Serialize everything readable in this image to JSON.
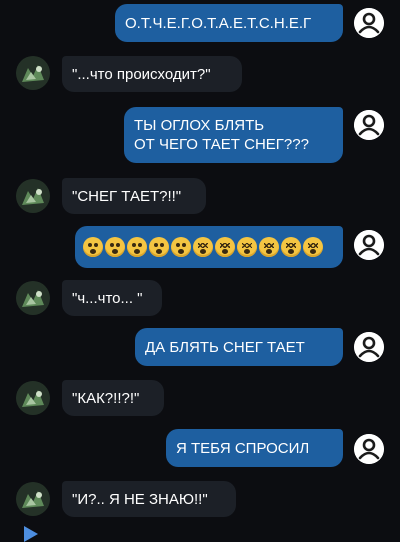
{
  "messages": [
    {
      "id": 1,
      "side": "out",
      "lines": [
        "О.Т.Ч.Е.Г.О.Т.А.Е.Т.С.Н.Е.Г"
      ]
    },
    {
      "id": 2,
      "side": "in",
      "lines": [
        "\"...что происходит?\""
      ]
    },
    {
      "id": 3,
      "side": "out",
      "lines": [
        "ТЫ ОГЛОХ БЛЯТЬ",
        "ОТ ЧЕГО ТАЕТ СНЕГ???"
      ]
    },
    {
      "id": 4,
      "side": "in",
      "lines": [
        "\"СНЕГ ТАЕТ?!!\""
      ]
    },
    {
      "id": 5,
      "side": "out",
      "emoji": [
        "😨",
        "😨",
        "😨",
        "😨",
        "😨",
        "😵",
        "😵",
        "😵",
        "😵",
        "😵",
        "😵"
      ]
    },
    {
      "id": 6,
      "side": "in",
      "lines": [
        "\"ч...что... \""
      ]
    },
    {
      "id": 7,
      "side": "out",
      "lines": [
        "ДА БЛЯТЬ СНЕГ ТАЕТ"
      ]
    },
    {
      "id": 8,
      "side": "in",
      "lines": [
        "\"КАК?!!?!\""
      ]
    },
    {
      "id": 9,
      "side": "out",
      "lines": [
        "Я ТЕБЯ СПРОСИЛ"
      ]
    },
    {
      "id": 10,
      "side": "in",
      "lines": [
        "\"И?.. Я НЕ ЗНАЮ!!\""
      ]
    }
  ],
  "icons": {
    "my_avatar": "user-avatar-icon",
    "their_avatar": "contact-avatar-icon",
    "play": "play-icon"
  },
  "colors": {
    "background": "#0c0d11",
    "outgoing_bubble": "#1e5fa0",
    "incoming_bubble": "#1c2027",
    "accent": "#4d8ee0"
  }
}
